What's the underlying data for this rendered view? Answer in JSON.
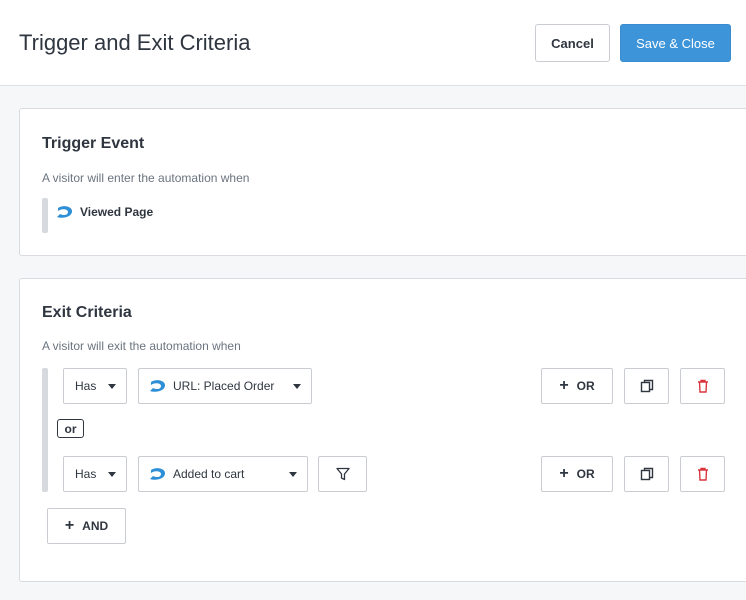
{
  "header": {
    "title": "Trigger and Exit Criteria",
    "cancel_label": "Cancel",
    "save_label": "Save & Close"
  },
  "trigger": {
    "title": "Trigger Event",
    "subtitle": "A visitor will enter the automation when",
    "event_label": "Viewed Page"
  },
  "exit": {
    "title": "Exit Criteria",
    "subtitle": "A visitor will exit the automation when",
    "connector_label": "or",
    "conditions": [
      {
        "qualifier": "Has",
        "event": "URL: Placed Order",
        "or_label": "OR"
      },
      {
        "qualifier": "Has",
        "event": "Added to cart",
        "or_label": "OR"
      }
    ],
    "and_label": "AND"
  },
  "colors": {
    "accent": "#3e94d8",
    "brand_icon": "#2e8fd6",
    "delete_icon": "#d9363e"
  },
  "icons": [
    "brand-swoosh-icon",
    "caret-down-icon",
    "filter-icon",
    "copy-icon",
    "trash-icon",
    "plus-icon"
  ]
}
